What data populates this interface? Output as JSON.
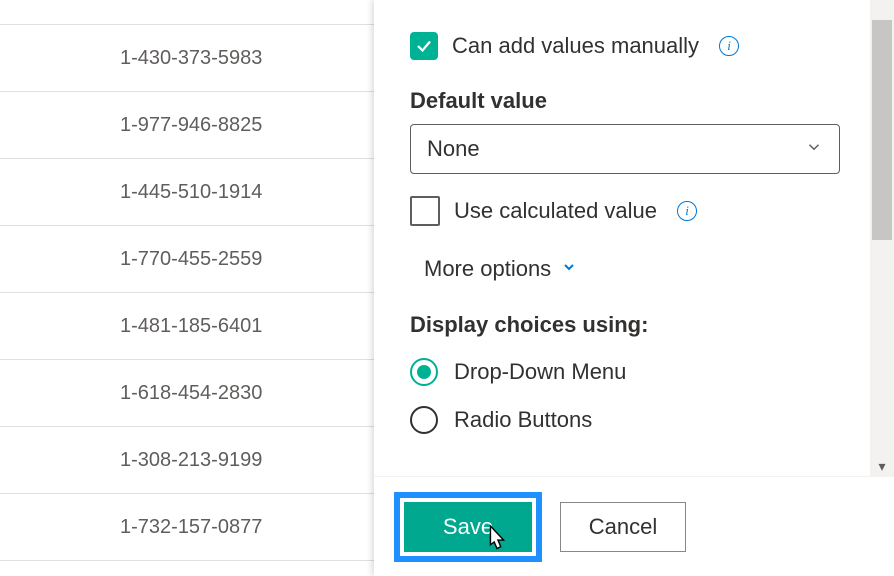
{
  "list": {
    "rows": [
      "1-430-373-5983",
      "1-977-946-8825",
      "1-445-510-1914",
      "1-770-455-2559",
      "1-481-185-6401",
      "1-618-454-2830",
      "1-308-213-9199",
      "1-732-157-0877"
    ]
  },
  "panel": {
    "can_add_manually": {
      "label": "Can add values manually",
      "checked": true
    },
    "default_value": {
      "label": "Default value",
      "selected": "None"
    },
    "use_calculated": {
      "label": "Use calculated value",
      "checked": false
    },
    "more_options": {
      "label": "More options"
    },
    "display_choices": {
      "label": "Display choices using:",
      "options": [
        {
          "label": "Drop-Down Menu",
          "selected": true
        },
        {
          "label": "Radio Buttons",
          "selected": false
        }
      ]
    }
  },
  "footer": {
    "save": "Save",
    "cancel": "Cancel"
  }
}
